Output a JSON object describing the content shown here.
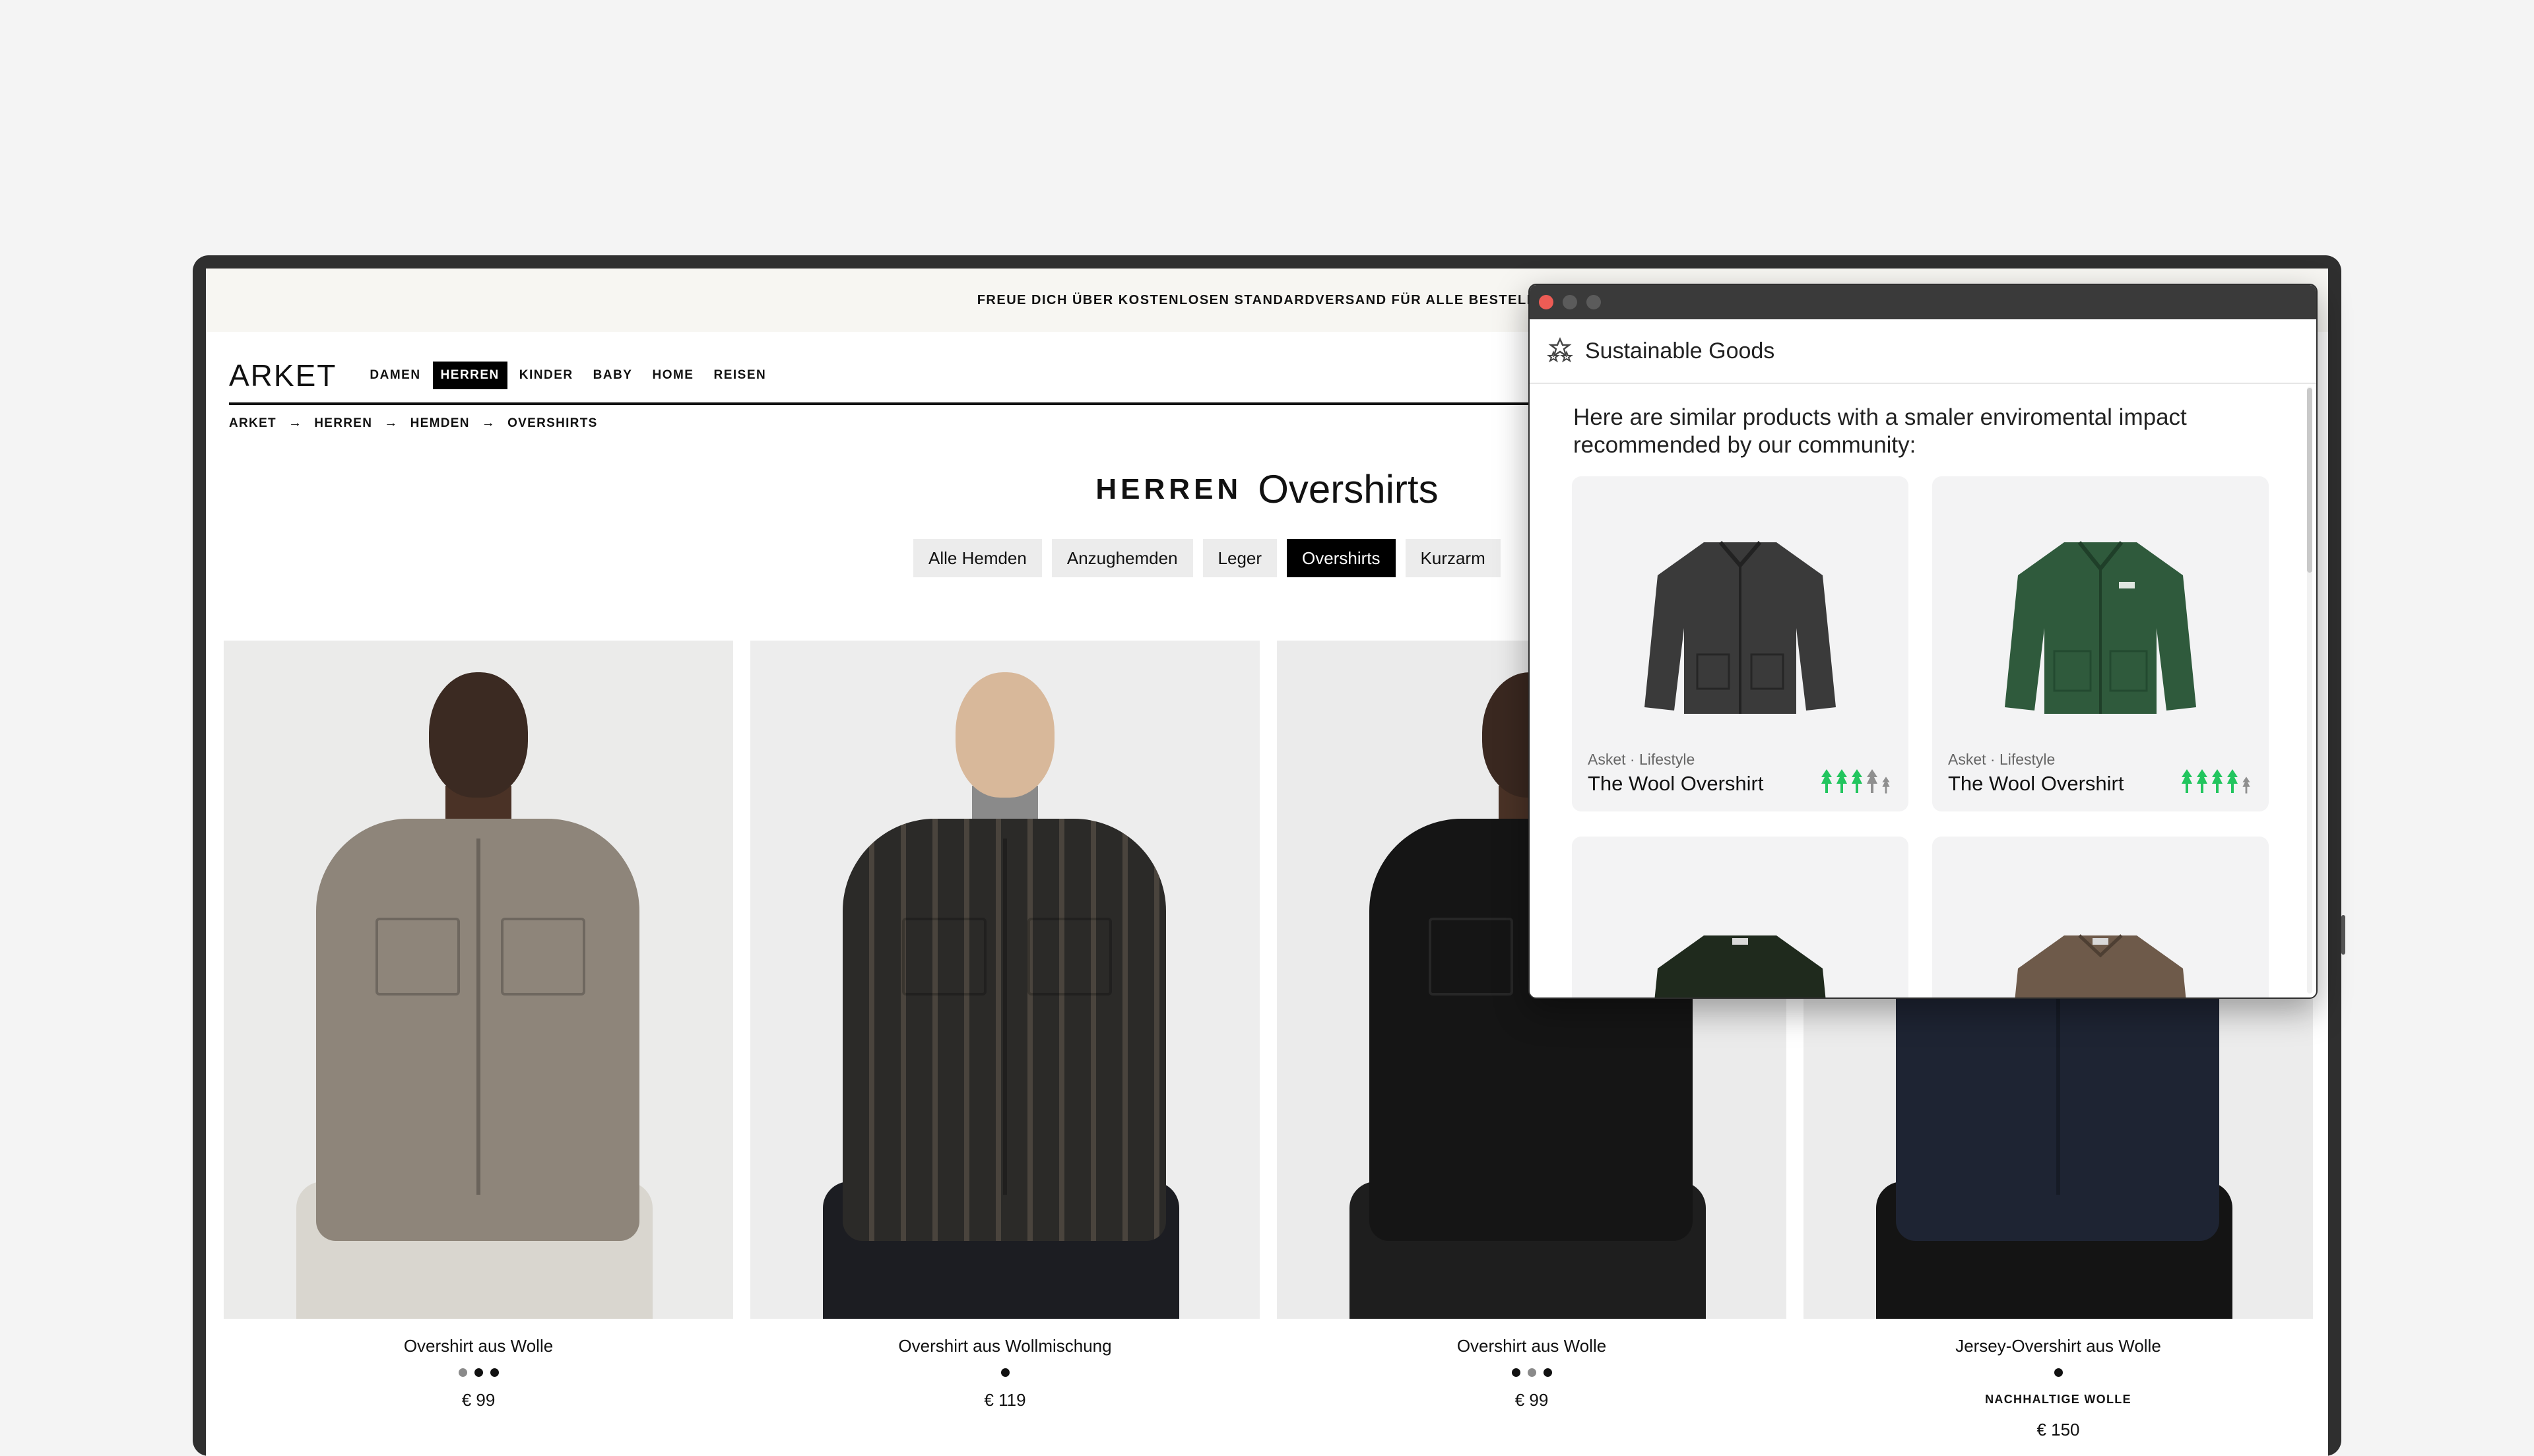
{
  "promo": {
    "text": "FREUE DICH ÜBER KOSTENLOSEN STANDARDVERSAND FÜR ALLE BESTELLUN"
  },
  "header": {
    "logo": "ARKET",
    "nav": [
      "DAMEN",
      "HERREN",
      "KINDER",
      "BABY",
      "HOME",
      "REISEN"
    ],
    "active_nav": "HERREN"
  },
  "breadcrumb": [
    "ARKET",
    "HERREN",
    "HEMDEN",
    "OVERSHIRTS"
  ],
  "page_title": {
    "section": "HERREN",
    "title": "Overshirts"
  },
  "filters": {
    "items": [
      "Alle Hemden",
      "Anzughemden",
      "Leger",
      "Overshirts",
      "Kurzarm"
    ],
    "active": "Overshirts"
  },
  "products": [
    {
      "name": "Overshirt aus Wolle",
      "price": "€ 99",
      "badge": "",
      "swatch_count": 3
    },
    {
      "name": "Overshirt aus Wollmischung",
      "price": "€ 119",
      "badge": "",
      "swatch_count": 1
    },
    {
      "name": "Overshirt aus Wolle",
      "price": "€ 99",
      "badge": "",
      "swatch_count": 3
    },
    {
      "name": "Jersey-Overshirt aus Wolle",
      "price": "€ 150",
      "badge": "NACHHALTIGE WOLLE",
      "swatch_count": 1
    }
  ],
  "popup": {
    "title": "Sustainable Goods",
    "intro": "Here are similar products with a smaler enviromental impact recommended by our community:",
    "cards": [
      {
        "meta": "Asket · Lifestyle",
        "name": "The Wool Overshirt",
        "rating": 3,
        "max_rating": 5
      },
      {
        "meta": "Asket · Lifestyle",
        "name": "The Wool Overshirt",
        "rating": 4,
        "max_rating": 5
      },
      {
        "meta": "",
        "name": "",
        "rating": 0,
        "max_rating": 5
      },
      {
        "meta": "",
        "name": "",
        "rating": 0,
        "max_rating": 5
      }
    ]
  },
  "colors": {
    "page_bg": "#f4f4f4",
    "promo_bg": "#f7f6f2",
    "rating_green": "#22c55e",
    "rating_grey": "#8f8f8f",
    "close_red": "#ed5c55"
  }
}
